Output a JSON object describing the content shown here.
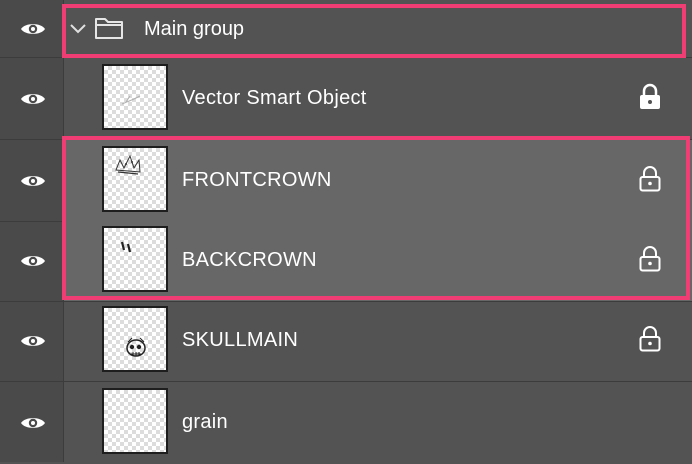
{
  "group": {
    "label": "Main group",
    "icons": [
      "eye-icon",
      "chevron-down-icon",
      "folder-icon"
    ]
  },
  "layers": [
    {
      "label": "Vector Smart Object",
      "locked": true,
      "selected": false
    },
    {
      "label": "FRONTCROWN",
      "locked": true,
      "selected": true
    },
    {
      "label": "BACKCROWN",
      "locked": true,
      "selected": true
    },
    {
      "label": "SKULLMAIN",
      "locked": true,
      "selected": false
    },
    {
      "label": "grain",
      "locked": false,
      "selected": false
    }
  ],
  "colors": {
    "panel_bg": "#535353",
    "selected_row_bg": "#676767",
    "highlight_border": "#f03e74",
    "text": "#ffffff"
  }
}
